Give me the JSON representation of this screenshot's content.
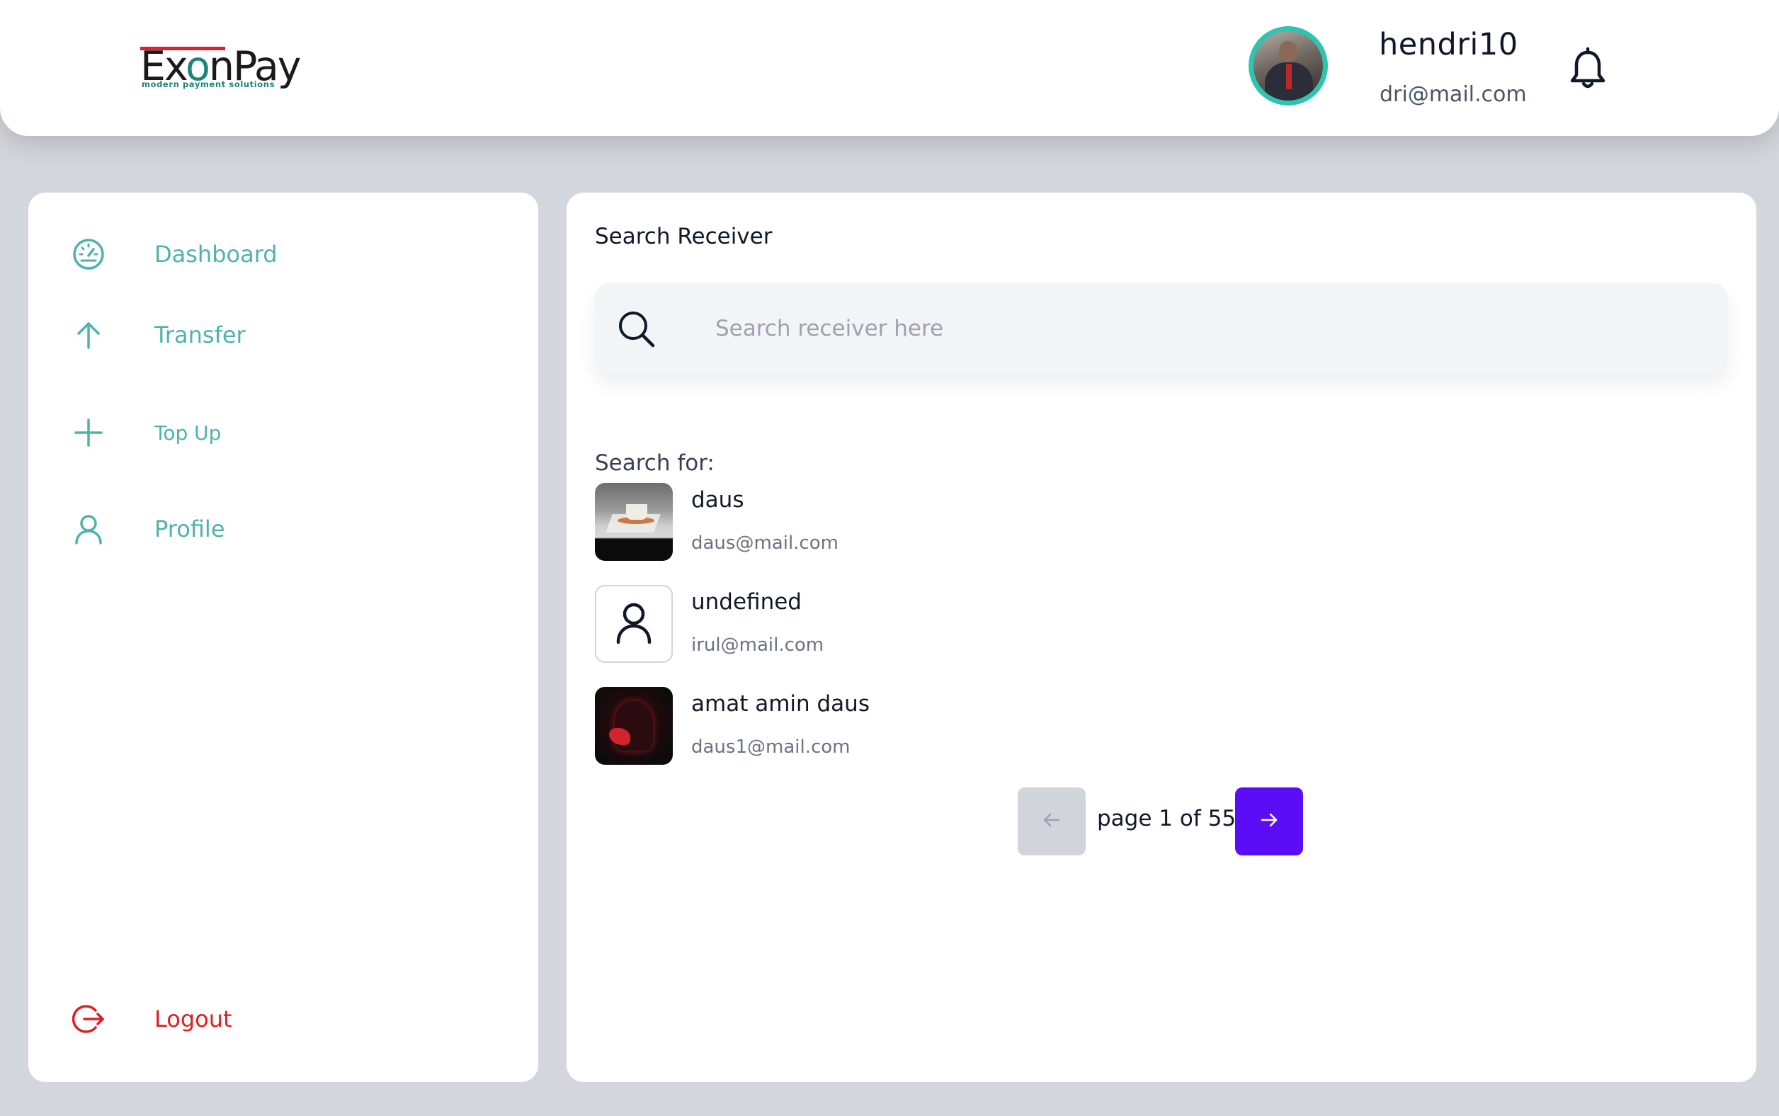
{
  "app": {
    "logo_main": "ExonPay",
    "logo_tagline": "modern payment solutions"
  },
  "user": {
    "name": "hendri10",
    "email": "dri@mail.com"
  },
  "sidebar": {
    "items": [
      {
        "label": "Dashboard",
        "icon": "speedometer-icon"
      },
      {
        "label": "Transfer",
        "icon": "arrow-up-icon"
      },
      {
        "label": "Top Up",
        "icon": "plus-icon"
      },
      {
        "label": "Profile",
        "icon": "user-icon"
      }
    ],
    "logout": {
      "label": "Logout",
      "icon": "logout-icon"
    }
  },
  "main": {
    "title": "Search Receiver",
    "search": {
      "placeholder": "Search receiver here",
      "value": ""
    },
    "search_for_label": "Search for:",
    "results": [
      {
        "name": "daus",
        "email": "daus@mail.com"
      },
      {
        "name": "undefined",
        "email": "irul@mail.com"
      },
      {
        "name": "amat amin daus",
        "email": "daus1@mail.com"
      }
    ],
    "pagination": {
      "text": "page 1 of 55",
      "current": 1,
      "total": 55
    }
  },
  "colors": {
    "accent_teal": "#4fb3a9",
    "logout_red": "#e11d1d",
    "primary_purple": "#5b0df5",
    "background": "#d3d6dc"
  }
}
